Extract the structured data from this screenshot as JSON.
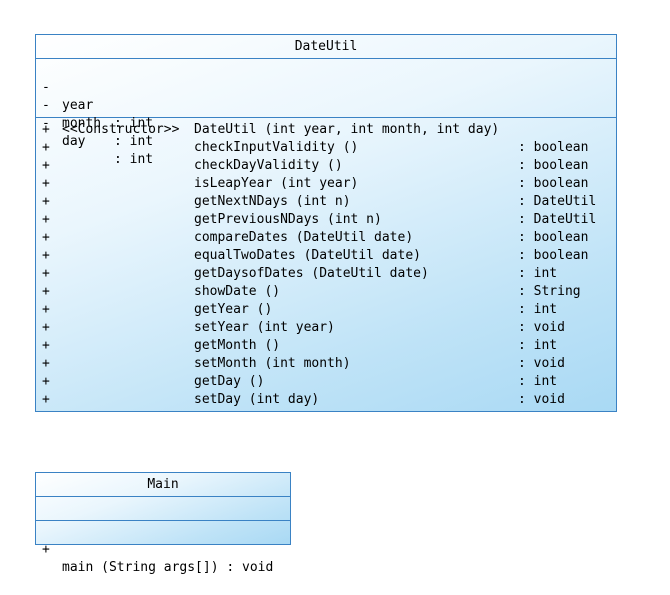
{
  "dateutil": {
    "name": "DateUtil",
    "attributes": [
      {
        "vis": "-",
        "name": "year",
        "type": ": int"
      },
      {
        "vis": "-",
        "name": "month",
        "type": ": int"
      },
      {
        "vis": "-",
        "name": "day",
        "type": ": int"
      }
    ],
    "operations": [
      {
        "vis": "+",
        "stereo": "<<Constructor>>",
        "sig": "DateUtil (int year, int month, int day)",
        "ret": ""
      },
      {
        "vis": "+",
        "stereo": "",
        "sig": "checkInputValidity ()",
        "ret": ": boolean"
      },
      {
        "vis": "+",
        "stereo": "",
        "sig": "checkDayValidity ()",
        "ret": ": boolean"
      },
      {
        "vis": "+",
        "stereo": "",
        "sig": "isLeapYear (int year)",
        "ret": ": boolean"
      },
      {
        "vis": "+",
        "stereo": "",
        "sig": "getNextNDays (int n)",
        "ret": ": DateUtil"
      },
      {
        "vis": "+",
        "stereo": "",
        "sig": "getPreviousNDays (int n)",
        "ret": ": DateUtil"
      },
      {
        "vis": "+",
        "stereo": "",
        "sig": "compareDates (DateUtil date)",
        "ret": ": boolean"
      },
      {
        "vis": "+",
        "stereo": "",
        "sig": "equalTwoDates (DateUtil date)",
        "ret": ": boolean"
      },
      {
        "vis": "+",
        "stereo": "",
        "sig": "getDaysofDates (DateUtil date)",
        "ret": ": int"
      },
      {
        "vis": "+",
        "stereo": "",
        "sig": "showDate ()",
        "ret": ": String"
      },
      {
        "vis": "+",
        "stereo": "",
        "sig": "getYear ()",
        "ret": ": int"
      },
      {
        "vis": "+",
        "stereo": "",
        "sig": "setYear (int year)",
        "ret": ": void"
      },
      {
        "vis": "+",
        "stereo": "",
        "sig": "getMonth ()",
        "ret": ": int"
      },
      {
        "vis": "+",
        "stereo": "",
        "sig": "setMonth (int month)",
        "ret": ": void"
      },
      {
        "vis": "+",
        "stereo": "",
        "sig": "getDay ()",
        "ret": ": int"
      },
      {
        "vis": "+",
        "stereo": "",
        "sig": "setDay (int day)",
        "ret": ": void"
      }
    ]
  },
  "main": {
    "name": "Main",
    "attributes": [],
    "operations": [
      {
        "vis": "+",
        "sig": "main (String args[]) : void"
      }
    ]
  },
  "colors": {
    "border": "#3a82c4",
    "fill_light": "#ffffff",
    "fill_dark": "#a9d9f4"
  }
}
